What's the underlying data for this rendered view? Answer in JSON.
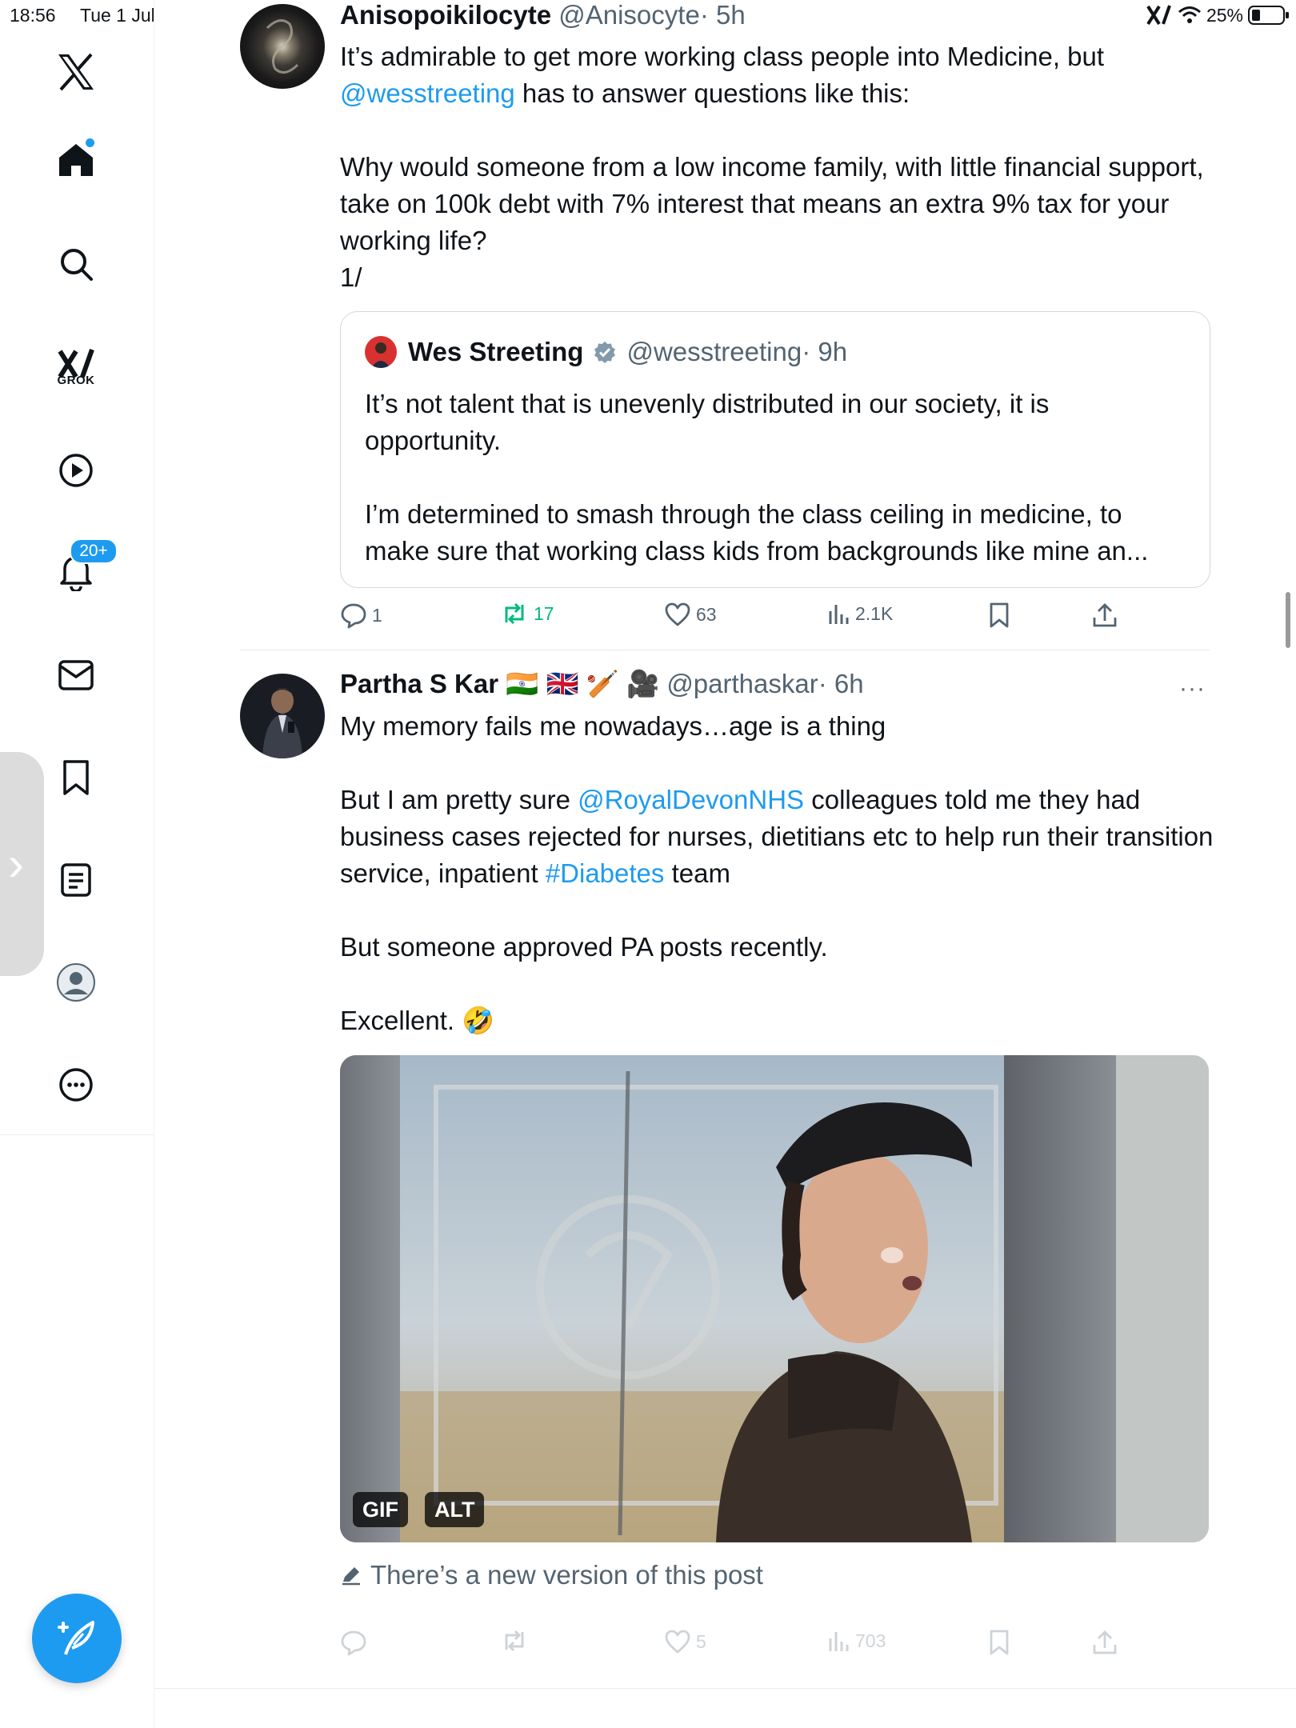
{
  "status_bar": {
    "time": "18:56",
    "date": "Tue 1 Jul",
    "battery": "25%"
  },
  "sidebar": {
    "grok_label": "GROK",
    "notifications_badge": "20+",
    "items": [
      "home",
      "search",
      "grok",
      "videos",
      "notifications",
      "messages",
      "bookmarks",
      "lists",
      "profile",
      "more"
    ]
  },
  "post1": {
    "author": "Anisopoikilocyte",
    "handle": "@Anisocyte",
    "time": "· 5h",
    "line1": "It’s admirable to get more working class people into Medicine, but",
    "mention": "@wesstreeting",
    "line2_rest": " has to answer questions like this:",
    "para2": "Why would someone from a low income family, with little financial support, take on 100k debt with 7% interest that means an extra 9% tax for your working life?",
    "para3": "1/",
    "quote": {
      "author": "Wes Streeting",
      "handle": "@wesstreeting",
      "time": "· 9h",
      "para1": "It’s not talent that is unevenly distributed in our society, it is opportunity.",
      "para2": "I’m determined to smash through the class ceiling in medicine, to make sure that working class kids from backgrounds like mine an..."
    },
    "actions": {
      "replies": "1",
      "reposts": "17",
      "likes": "63",
      "views": "2.1K"
    }
  },
  "post2": {
    "author": "Partha S Kar",
    "author_emojis": "🇮🇳 🇬🇧 🏏 🎥",
    "handle": "@parthaskar",
    "time": "· 6h",
    "more": "···",
    "line1": "My memory fails me nowadays…age is a thing",
    "p2_a": "But I am pretty sure ",
    "p2_mention": "@RoyalDevonNHS",
    "p2_b": " colleagues told me they had business cases rejected for nurses, dietitians etc to help run their transition service, inpatient ",
    "p2_hashtag": "#Diabetes",
    "p2_c": " team",
    "para3": "But someone approved PA posts recently.",
    "para4": "Excellent. 🤣",
    "media_badges": {
      "gif": "GIF",
      "alt": "ALT"
    },
    "new_version": "There’s a new version of this post",
    "actions": {
      "replies": "",
      "reposts": "",
      "likes": "5",
      "views": "703"
    }
  },
  "colors": {
    "accent": "#1d9bf0",
    "repost_green": "#00ba7c",
    "text": "#0f1419",
    "muted": "#536471"
  }
}
